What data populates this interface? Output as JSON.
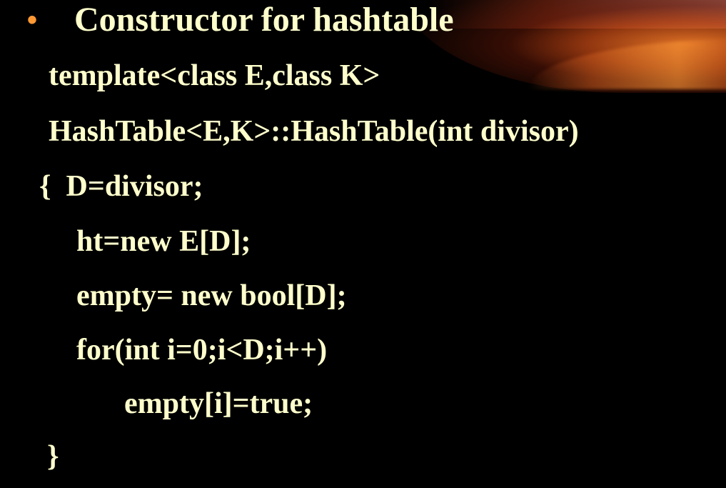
{
  "slide": {
    "bullet": "•",
    "title": "Constructor for hashtable",
    "code_lines": [
      "template<class E,class K>",
      "HashTable<E,K>::HashTable(int divisor)",
      "{  D=divisor;",
      "ht=new E[D];",
      "empty= new bool[D];",
      "for(int i=0;i<D;i++)",
      "empty[i]=true;",
      "}"
    ]
  },
  "colors": {
    "background": "#000000",
    "text": "#ffffcc",
    "bullet": "#ff9933",
    "accent_glow": "#e87828"
  }
}
